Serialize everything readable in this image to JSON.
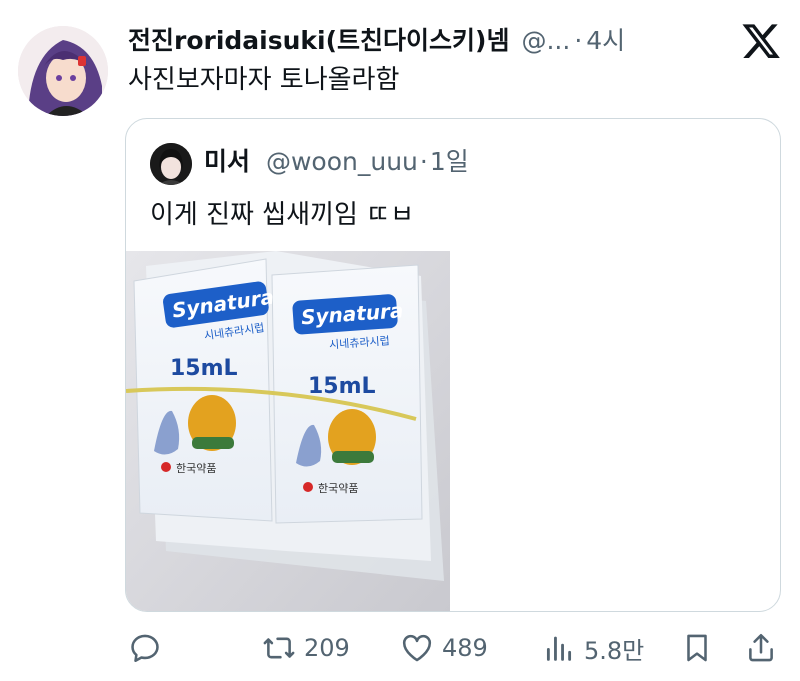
{
  "author": {
    "display_name": "전진roridaisuki(트친다이스키)넴",
    "handle": "@...",
    "time": "4시"
  },
  "tweet": {
    "text": "사진보자마자 토나올라함"
  },
  "quoted": {
    "display_name": "미서",
    "handle": "@woon_uuu",
    "time": "1일",
    "text": "이게 진짜 씹새끼임 ㄸㅂ",
    "photo": {
      "brand": "Synatura",
      "brand_korean": "시네츄라시럽",
      "volume": "15mL",
      "maker": "한국약품"
    }
  },
  "actions": {
    "reply_icon": "speech-bubble-icon",
    "retweet_count": "209",
    "like_count": "489",
    "views_count": "5.8만",
    "bookmark_icon": "bookmark-icon",
    "share_icon": "share-icon"
  },
  "colors": {
    "text": "#0f1419",
    "secondary": "#536471",
    "border": "#cfd9de",
    "brand_blue": "#1d5fc8"
  }
}
